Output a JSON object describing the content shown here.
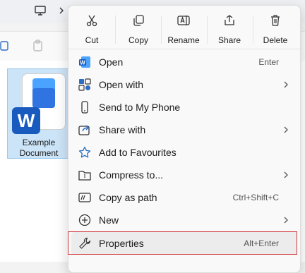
{
  "quick_actions": [
    {
      "label": "Cut",
      "icon": "scissors-icon"
    },
    {
      "label": "Copy",
      "icon": "copy-icon"
    },
    {
      "label": "Rename",
      "icon": "rename-icon"
    },
    {
      "label": "Share",
      "icon": "share-icon"
    },
    {
      "label": "Delete",
      "icon": "trash-icon"
    }
  ],
  "menu": {
    "open": {
      "label": "Open",
      "shortcut": "Enter",
      "icon": "word-icon"
    },
    "open_with": {
      "label": "Open with",
      "icon": "open-with-icon"
    },
    "send_phone": {
      "label": "Send to My Phone",
      "icon": "phone-icon"
    },
    "share_with": {
      "label": "Share with",
      "icon": "share-with-icon"
    },
    "favourites": {
      "label": "Add to Favourites",
      "icon": "star-icon"
    },
    "compress": {
      "label": "Compress to...",
      "icon": "zip-folder-icon"
    },
    "copy_path": {
      "label": "Copy as path",
      "shortcut": "Ctrl+Shift+C",
      "icon": "path-icon"
    },
    "new": {
      "label": "New",
      "icon": "plus-circle-icon"
    },
    "properties": {
      "label": "Properties",
      "shortcut": "Alt+Enter",
      "icon": "wrench-icon"
    }
  },
  "file": {
    "name_line1": "Example",
    "name_line2": "Document",
    "badge": "W"
  },
  "colors": {
    "accent": "#185abd",
    "selection": "#cce4f7",
    "highlight": "#d13438"
  }
}
